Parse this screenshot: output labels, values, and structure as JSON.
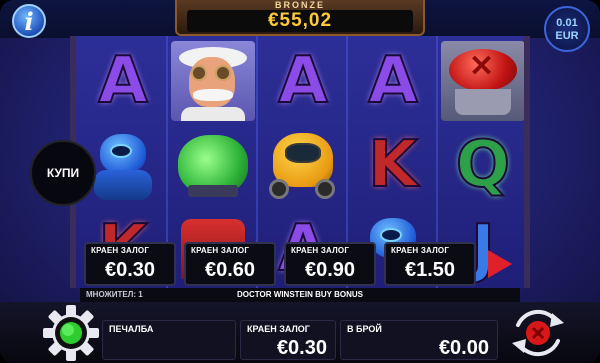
{
  "top": {
    "jackpot_tier": "BRONZE",
    "jackpot_amount": "€55,02",
    "denomination_value": "0.01",
    "denomination_currency": "EUR",
    "info_icon": "info-icon"
  },
  "reels": {
    "row1": [
      "A",
      "doctor-winstein",
      "A",
      "A",
      "red-button"
    ],
    "row2": [
      "blue-robot",
      "green-brain",
      "yellow-robot",
      "K",
      "Q"
    ],
    "row3_partial": [
      "K",
      "red-robot",
      "A",
      "blue-robot",
      "J"
    ]
  },
  "buy_button": {
    "label": "КУПИ"
  },
  "bet_options": [
    {
      "label": "КРАЕН ЗАЛОГ",
      "value": "€0.30"
    },
    {
      "label": "КРАЕН ЗАЛОГ",
      "value": "€0.60"
    },
    {
      "label": "КРАЕН ЗАЛОГ",
      "value": "€0.90"
    },
    {
      "label": "КРАЕН ЗАЛОГ",
      "value": "€1.50"
    }
  ],
  "strip": {
    "multiplier": "МНОЖИТЕЛ: 1",
    "buy_bonus": "DOCTOR WINSTEIN BUY BONUS"
  },
  "bottom": {
    "win_label": "ПЕЧАЛБА",
    "win_value": "",
    "total_bet_label": "КРАЕН ЗАЛОГ",
    "total_bet_value": "€0.30",
    "cash_label": "В БРОЙ",
    "cash_value": "€0.00"
  },
  "colors": {
    "jackpot": "#ffc93a",
    "accent_red": "#e0202a",
    "settings_green": "#2ecc2e"
  }
}
